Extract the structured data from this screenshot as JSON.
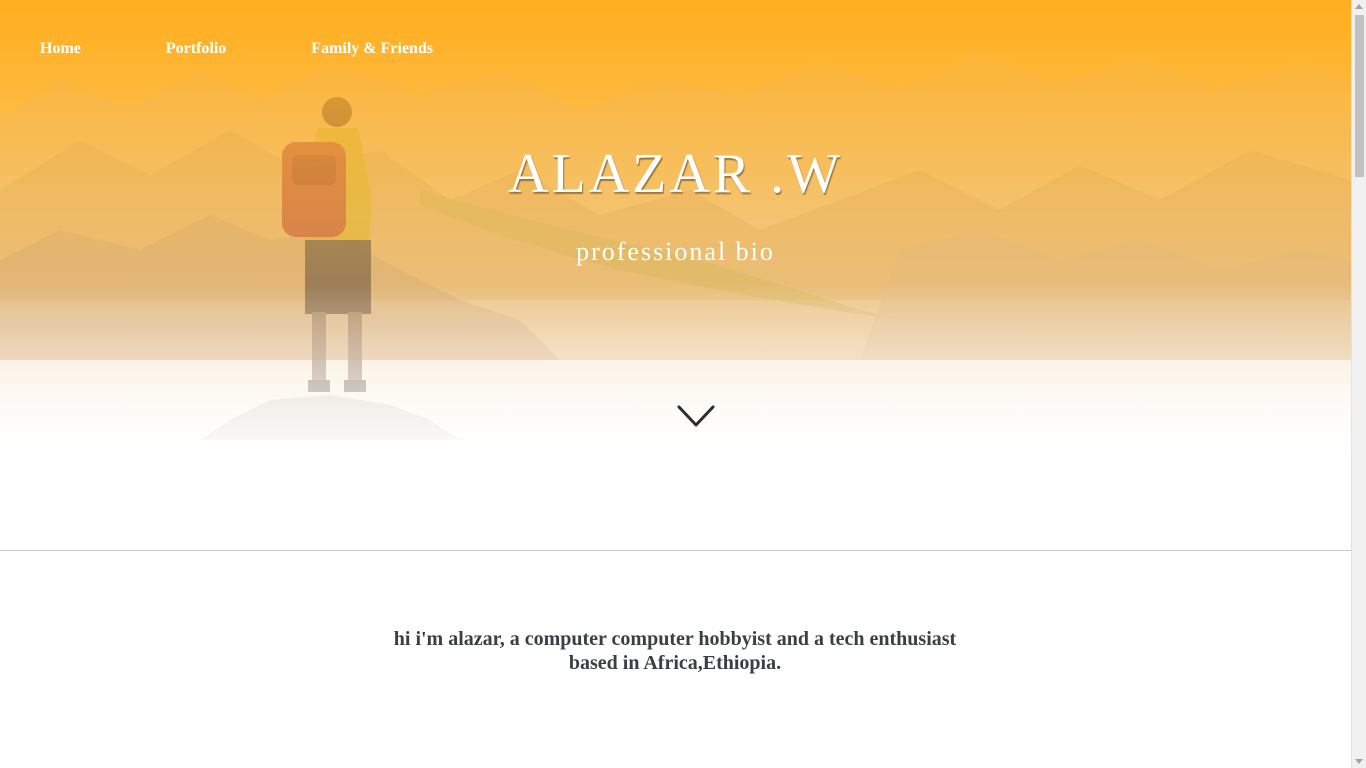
{
  "nav": {
    "items": [
      {
        "label": "Home"
      },
      {
        "label": "Portfolio"
      },
      {
        "label": "Family & Friends"
      }
    ]
  },
  "hero": {
    "title": "ALAZAR .W",
    "subtitle": "professional bio",
    "scroll_icon": "chevron-down-icon",
    "overlay_color": "#ffb32b"
  },
  "about": {
    "bio_line_1": "hi i'm alazar, a computer computer hobbyist and a tech enthusiast",
    "bio_line_2": "based in Africa,Ethiopia."
  },
  "colors": {
    "accent": "#ffb32b",
    "text_dark": "#3a3f47",
    "divider": "#c8c8c8"
  }
}
